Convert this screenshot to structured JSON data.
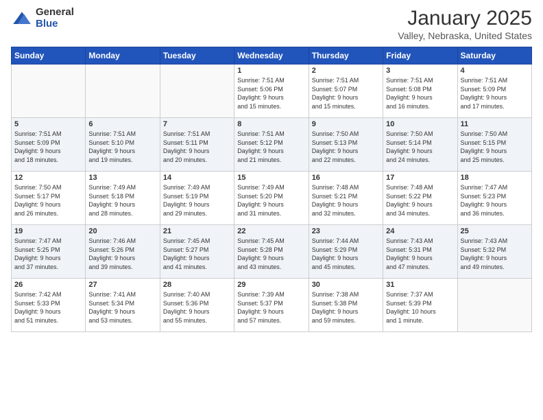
{
  "header": {
    "logo_general": "General",
    "logo_blue": "Blue",
    "title": "January 2025",
    "subtitle": "Valley, Nebraska, United States"
  },
  "days_of_week": [
    "Sunday",
    "Monday",
    "Tuesday",
    "Wednesday",
    "Thursday",
    "Friday",
    "Saturday"
  ],
  "weeks": [
    [
      {
        "day": "",
        "info": ""
      },
      {
        "day": "",
        "info": ""
      },
      {
        "day": "",
        "info": ""
      },
      {
        "day": "1",
        "info": "Sunrise: 7:51 AM\nSunset: 5:06 PM\nDaylight: 9 hours\nand 15 minutes."
      },
      {
        "day": "2",
        "info": "Sunrise: 7:51 AM\nSunset: 5:07 PM\nDaylight: 9 hours\nand 15 minutes."
      },
      {
        "day": "3",
        "info": "Sunrise: 7:51 AM\nSunset: 5:08 PM\nDaylight: 9 hours\nand 16 minutes."
      },
      {
        "day": "4",
        "info": "Sunrise: 7:51 AM\nSunset: 5:09 PM\nDaylight: 9 hours\nand 17 minutes."
      }
    ],
    [
      {
        "day": "5",
        "info": "Sunrise: 7:51 AM\nSunset: 5:09 PM\nDaylight: 9 hours\nand 18 minutes."
      },
      {
        "day": "6",
        "info": "Sunrise: 7:51 AM\nSunset: 5:10 PM\nDaylight: 9 hours\nand 19 minutes."
      },
      {
        "day": "7",
        "info": "Sunrise: 7:51 AM\nSunset: 5:11 PM\nDaylight: 9 hours\nand 20 minutes."
      },
      {
        "day": "8",
        "info": "Sunrise: 7:51 AM\nSunset: 5:12 PM\nDaylight: 9 hours\nand 21 minutes."
      },
      {
        "day": "9",
        "info": "Sunrise: 7:50 AM\nSunset: 5:13 PM\nDaylight: 9 hours\nand 22 minutes."
      },
      {
        "day": "10",
        "info": "Sunrise: 7:50 AM\nSunset: 5:14 PM\nDaylight: 9 hours\nand 24 minutes."
      },
      {
        "day": "11",
        "info": "Sunrise: 7:50 AM\nSunset: 5:15 PM\nDaylight: 9 hours\nand 25 minutes."
      }
    ],
    [
      {
        "day": "12",
        "info": "Sunrise: 7:50 AM\nSunset: 5:17 PM\nDaylight: 9 hours\nand 26 minutes."
      },
      {
        "day": "13",
        "info": "Sunrise: 7:49 AM\nSunset: 5:18 PM\nDaylight: 9 hours\nand 28 minutes."
      },
      {
        "day": "14",
        "info": "Sunrise: 7:49 AM\nSunset: 5:19 PM\nDaylight: 9 hours\nand 29 minutes."
      },
      {
        "day": "15",
        "info": "Sunrise: 7:49 AM\nSunset: 5:20 PM\nDaylight: 9 hours\nand 31 minutes."
      },
      {
        "day": "16",
        "info": "Sunrise: 7:48 AM\nSunset: 5:21 PM\nDaylight: 9 hours\nand 32 minutes."
      },
      {
        "day": "17",
        "info": "Sunrise: 7:48 AM\nSunset: 5:22 PM\nDaylight: 9 hours\nand 34 minutes."
      },
      {
        "day": "18",
        "info": "Sunrise: 7:47 AM\nSunset: 5:23 PM\nDaylight: 9 hours\nand 36 minutes."
      }
    ],
    [
      {
        "day": "19",
        "info": "Sunrise: 7:47 AM\nSunset: 5:25 PM\nDaylight: 9 hours\nand 37 minutes."
      },
      {
        "day": "20",
        "info": "Sunrise: 7:46 AM\nSunset: 5:26 PM\nDaylight: 9 hours\nand 39 minutes."
      },
      {
        "day": "21",
        "info": "Sunrise: 7:45 AM\nSunset: 5:27 PM\nDaylight: 9 hours\nand 41 minutes."
      },
      {
        "day": "22",
        "info": "Sunrise: 7:45 AM\nSunset: 5:28 PM\nDaylight: 9 hours\nand 43 minutes."
      },
      {
        "day": "23",
        "info": "Sunrise: 7:44 AM\nSunset: 5:29 PM\nDaylight: 9 hours\nand 45 minutes."
      },
      {
        "day": "24",
        "info": "Sunrise: 7:43 AM\nSunset: 5:31 PM\nDaylight: 9 hours\nand 47 minutes."
      },
      {
        "day": "25",
        "info": "Sunrise: 7:43 AM\nSunset: 5:32 PM\nDaylight: 9 hours\nand 49 minutes."
      }
    ],
    [
      {
        "day": "26",
        "info": "Sunrise: 7:42 AM\nSunset: 5:33 PM\nDaylight: 9 hours\nand 51 minutes."
      },
      {
        "day": "27",
        "info": "Sunrise: 7:41 AM\nSunset: 5:34 PM\nDaylight: 9 hours\nand 53 minutes."
      },
      {
        "day": "28",
        "info": "Sunrise: 7:40 AM\nSunset: 5:36 PM\nDaylight: 9 hours\nand 55 minutes."
      },
      {
        "day": "29",
        "info": "Sunrise: 7:39 AM\nSunset: 5:37 PM\nDaylight: 9 hours\nand 57 minutes."
      },
      {
        "day": "30",
        "info": "Sunrise: 7:38 AM\nSunset: 5:38 PM\nDaylight: 9 hours\nand 59 minutes."
      },
      {
        "day": "31",
        "info": "Sunrise: 7:37 AM\nSunset: 5:39 PM\nDaylight: 10 hours\nand 1 minute."
      },
      {
        "day": "",
        "info": ""
      }
    ]
  ]
}
